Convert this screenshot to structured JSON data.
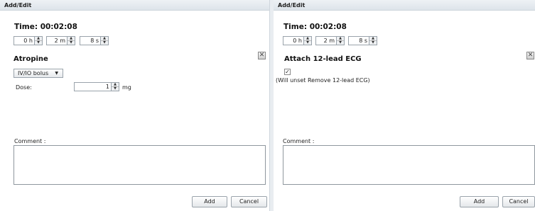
{
  "panels": [
    {
      "window_title": "Add/Edit",
      "time_label": "Time:",
      "time_value": "00:02:08",
      "hours": "0 h",
      "minutes": "2 m",
      "seconds": "8 s",
      "section_title": "Atropine",
      "route_value": "IV/IO bolus",
      "dose_label": "Dose:",
      "dose_value": "1",
      "dose_unit": "mg",
      "comment_label": "Comment :",
      "comment_value": "",
      "add_label": "Add",
      "cancel_label": "Cancel"
    },
    {
      "window_title": "Add/Edit",
      "time_label": "Time:",
      "time_value": "00:02:08",
      "hours": "0 h",
      "minutes": "2 m",
      "seconds": "8 s",
      "section_title": "Attach 12-lead ECG",
      "checkbox_checked": true,
      "note": "(Will unset Remove 12-lead ECG)",
      "comment_label": "Comment :",
      "comment_value": "",
      "add_label": "Add",
      "cancel_label": "Cancel"
    }
  ],
  "icons": {
    "close": "close-x-icon",
    "spinner_up": "up-arrow-icon",
    "spinner_down": "down-arrow-icon",
    "dropdown": "chevron-down-icon",
    "check": "checkmark-icon"
  }
}
